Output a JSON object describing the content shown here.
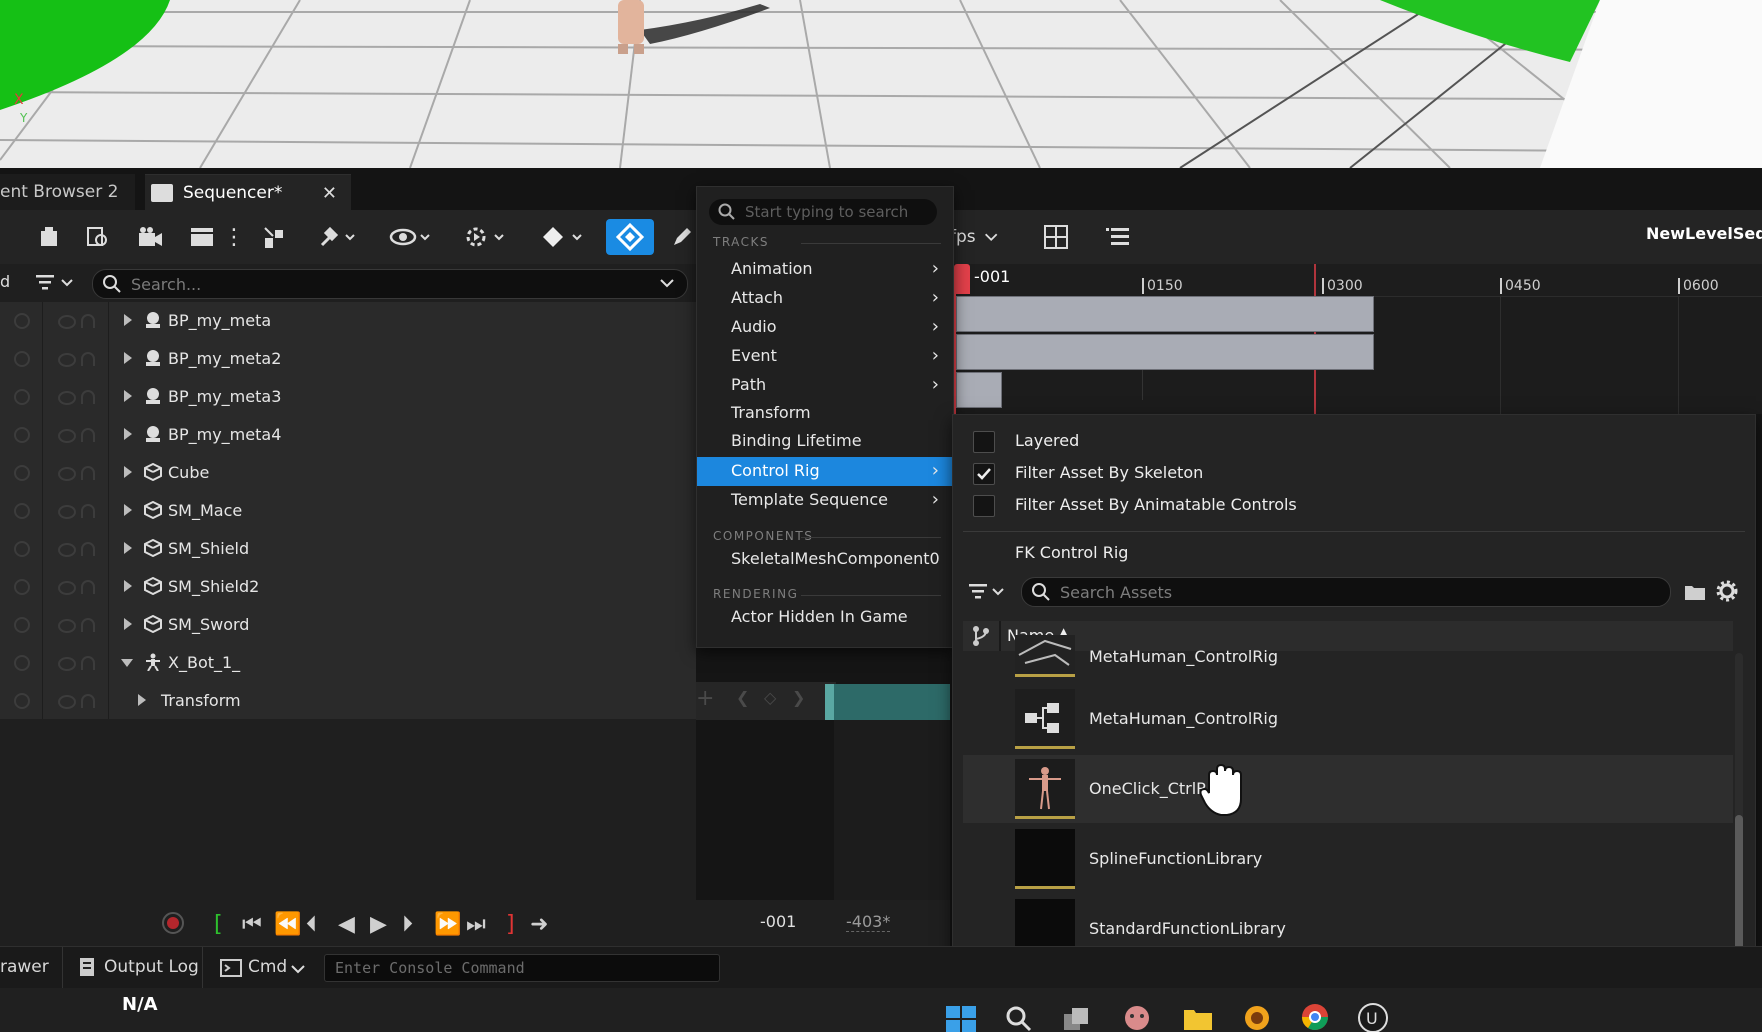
{
  "tabs": {
    "content_browser": "ent Browser 2",
    "sequencer": "Sequencer*"
  },
  "toolbar": {
    "fps_label": "fps",
    "sequence_name": "NewLevelSequ"
  },
  "outliner": {
    "search_placeholder": "Search...",
    "header_left": "d",
    "rows": [
      {
        "label": "BP_my_meta"
      },
      {
        "label": "BP_my_meta2"
      },
      {
        "label": "BP_my_meta3"
      },
      {
        "label": "BP_my_meta4"
      },
      {
        "label": "Cube"
      },
      {
        "label": "SM_Mace"
      },
      {
        "label": "SM_Shield"
      },
      {
        "label": "SM_Shield2"
      },
      {
        "label": "SM_Sword"
      },
      {
        "label": "X_Bot_1_"
      },
      {
        "label": "Transform"
      }
    ]
  },
  "timeline": {
    "current_frame": "-001",
    "ticks": [
      "0150",
      "0300",
      "0450",
      "0600"
    ]
  },
  "transport": {
    "frame_now": "-001",
    "frame_end": "-403*"
  },
  "menu": {
    "search_placeholder": "Start typing to search",
    "section_tracks": "TRACKS",
    "section_components": "COMPONENTS",
    "section_rendering": "RENDERING",
    "items": {
      "animation": "Animation",
      "attach": "Attach",
      "audio": "Audio",
      "event": "Event",
      "path": "Path",
      "transform": "Transform",
      "binding_lifetime": "Binding Lifetime",
      "control_rig": "Control Rig",
      "template_sequence": "Template Sequence",
      "skeletal_mesh_component": "SkeletalMeshComponent0",
      "actor_hidden": "Actor Hidden In Game"
    }
  },
  "submenu": {
    "layered": "Layered",
    "filter_by_skeleton": "Filter Asset By Skeleton",
    "filter_by_controls": "Filter Asset By Animatable Controls",
    "fk_control_rig": "FK Control Rig",
    "search_placeholder": "Search Assets",
    "column_name": "Name",
    "assets": [
      {
        "name": "MetaHuman_ControlRig"
      },
      {
        "name": "MetaHuman_ControlRig"
      },
      {
        "name": "OneClick_CtrlRig"
      },
      {
        "name": "SplineFunctionLibrary"
      },
      {
        "name": "StandardFunctionLibrary"
      }
    ]
  },
  "statusbar": {
    "drawer": "rawer",
    "output_log": "Output Log",
    "cmd": "Cmd",
    "console_placeholder": "Enter Console Command",
    "na": "N/A"
  },
  "colors": {
    "accent": "#1c87de",
    "playhead": "#e2404a",
    "section_teal": "#5aa7a2",
    "viewport_green": "#1ec21e"
  }
}
